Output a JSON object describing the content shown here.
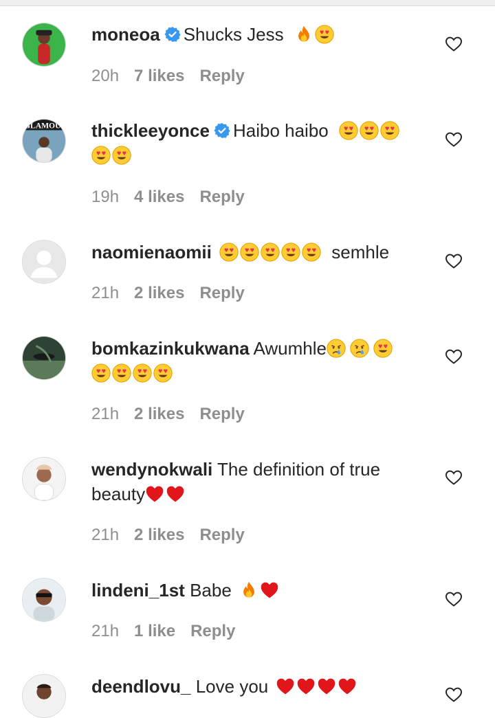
{
  "comments": [
    {
      "username": "moneoa",
      "verified": true,
      "text": "Shucks Jess",
      "emojis_after": [
        "fire",
        "heart-eyes"
      ],
      "time": "20h",
      "likes": "7 likes",
      "reply": "Reply"
    },
    {
      "username": "thickleeyonce",
      "verified": true,
      "text": "Haibo haibo",
      "emojis_after": [
        "heart-eyes",
        "heart-eyes",
        "heart-eyes",
        "heart-eyes",
        "heart-eyes"
      ],
      "time": "19h",
      "likes": "4 likes",
      "reply": "Reply",
      "avatar_text": "GLAMOUR"
    },
    {
      "username": "naomienaomii",
      "verified": false,
      "text": "semhle",
      "emojis_before": [
        "heart-eyes",
        "heart-eyes",
        "heart-eyes",
        "heart-eyes",
        "heart-eyes"
      ],
      "time": "21h",
      "likes": "2 likes",
      "reply": "Reply"
    },
    {
      "username": "bomkazinkukwana",
      "verified": false,
      "text": "Awumhle",
      "emojis_after": [
        "crying",
        "crying",
        "heart-eyes",
        "heart-eyes",
        "heart-eyes",
        "heart-eyes",
        "heart-eyes"
      ],
      "time": "21h",
      "likes": "2 likes",
      "reply": "Reply"
    },
    {
      "username": "wendynokwali",
      "verified": false,
      "text": "The definition of true beauty",
      "emojis_after": [
        "red-heart",
        "red-heart"
      ],
      "time": "21h",
      "likes": "2 likes",
      "reply": "Reply"
    },
    {
      "username": "lindeni_1st",
      "verified": false,
      "text": "Babe",
      "emojis_after": [
        "fire",
        "red-heart"
      ],
      "time": "21h",
      "likes": "1 like",
      "reply": "Reply"
    },
    {
      "username": "deendlovu_",
      "verified": false,
      "text": "Love you",
      "emojis_after": [
        "red-heart",
        "red-heart",
        "red-heart",
        "red-heart"
      ]
    }
  ],
  "icons": {
    "like": "heart-outline-icon",
    "verified": "verified-badge-icon"
  },
  "colors": {
    "verified": "#3897f0",
    "meta": "#8e8e8e",
    "text": "#262626",
    "heart_red": "#e0161b",
    "emoji_yellow": "#ffcc33"
  }
}
